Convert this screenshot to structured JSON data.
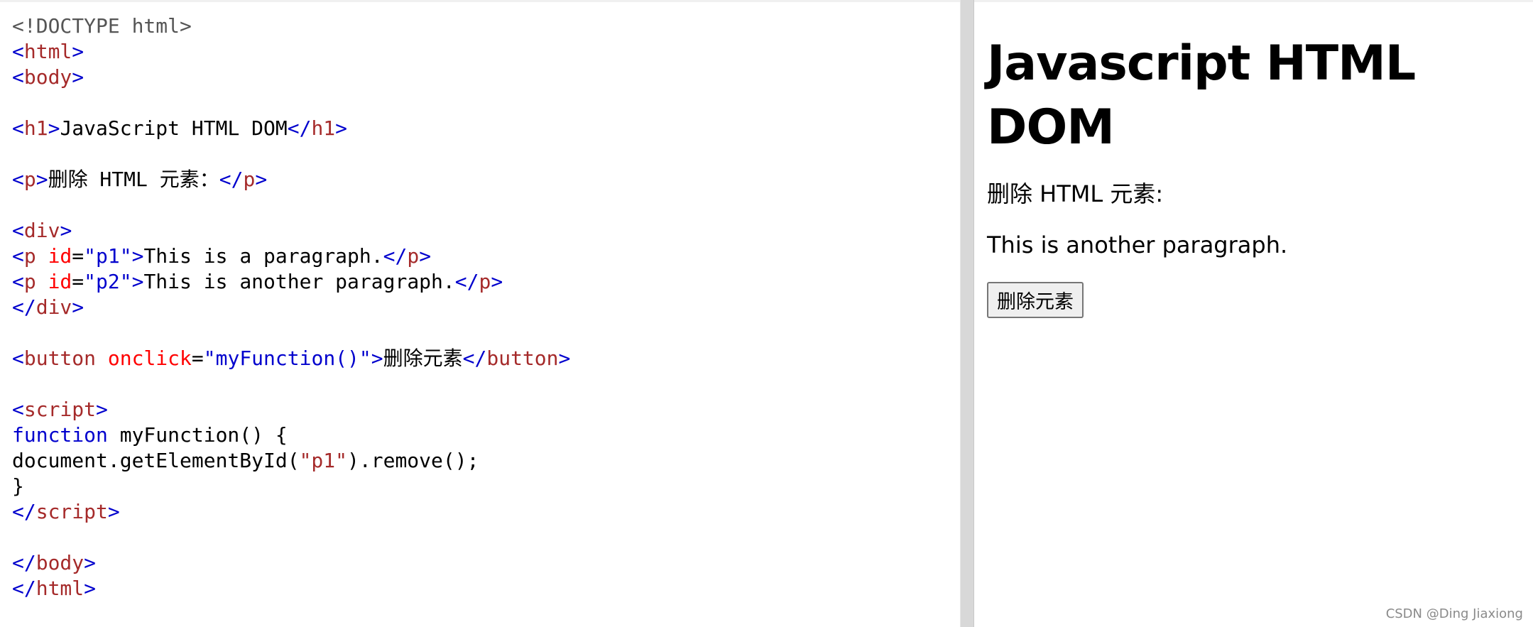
{
  "code_editor": {
    "lines": [
      [
        {
          "c": "t-doc",
          "t": "<!DOCTYPE html>"
        }
      ],
      [
        {
          "c": "t-br",
          "t": "<"
        },
        {
          "c": "t-tag",
          "t": "html"
        },
        {
          "c": "t-br",
          "t": ">"
        }
      ],
      [
        {
          "c": "t-br",
          "t": "<"
        },
        {
          "c": "t-tag",
          "t": "body"
        },
        {
          "c": "t-br",
          "t": ">"
        }
      ],
      [],
      [
        {
          "c": "t-br",
          "t": "<"
        },
        {
          "c": "t-tag",
          "t": "h1"
        },
        {
          "c": "t-br",
          "t": ">"
        },
        {
          "c": "t-txt",
          "t": "JavaScript HTML DOM"
        },
        {
          "c": "t-br",
          "t": "</"
        },
        {
          "c": "t-tag",
          "t": "h1"
        },
        {
          "c": "t-br",
          "t": ">"
        }
      ],
      [],
      [
        {
          "c": "t-br",
          "t": "<"
        },
        {
          "c": "t-tag",
          "t": "p"
        },
        {
          "c": "t-br",
          "t": ">"
        },
        {
          "c": "t-txt",
          "t": "删除 HTML 元素："
        },
        {
          "c": "t-br",
          "t": "</"
        },
        {
          "c": "t-tag",
          "t": "p"
        },
        {
          "c": "t-br",
          "t": ">"
        }
      ],
      [],
      [
        {
          "c": "t-br",
          "t": "<"
        },
        {
          "c": "t-tag",
          "t": "div"
        },
        {
          "c": "t-br",
          "t": ">"
        }
      ],
      [
        {
          "c": "t-br",
          "t": "<"
        },
        {
          "c": "t-tag",
          "t": "p"
        },
        {
          "c": "t-txt",
          "t": " "
        },
        {
          "c": "t-attr",
          "t": "id"
        },
        {
          "c": "t-txt",
          "t": "="
        },
        {
          "c": "t-val",
          "t": "\"p1\""
        },
        {
          "c": "t-br",
          "t": ">"
        },
        {
          "c": "t-txt",
          "t": "This is a paragraph."
        },
        {
          "c": "t-br",
          "t": "</"
        },
        {
          "c": "t-tag",
          "t": "p"
        },
        {
          "c": "t-br",
          "t": ">"
        }
      ],
      [
        {
          "c": "t-br",
          "t": "<"
        },
        {
          "c": "t-tag",
          "t": "p"
        },
        {
          "c": "t-txt",
          "t": " "
        },
        {
          "c": "t-attr",
          "t": "id"
        },
        {
          "c": "t-txt",
          "t": "="
        },
        {
          "c": "t-val",
          "t": "\"p2\""
        },
        {
          "c": "t-br",
          "t": ">"
        },
        {
          "c": "t-txt",
          "t": "This is another paragraph."
        },
        {
          "c": "t-br",
          "t": "</"
        },
        {
          "c": "t-tag",
          "t": "p"
        },
        {
          "c": "t-br",
          "t": ">"
        }
      ],
      [
        {
          "c": "t-br",
          "t": "</"
        },
        {
          "c": "t-tag",
          "t": "div"
        },
        {
          "c": "t-br",
          "t": ">"
        }
      ],
      [],
      [
        {
          "c": "t-br",
          "t": "<"
        },
        {
          "c": "t-tag",
          "t": "button"
        },
        {
          "c": "t-txt",
          "t": " "
        },
        {
          "c": "t-attr",
          "t": "onclick"
        },
        {
          "c": "t-txt",
          "t": "="
        },
        {
          "c": "t-val",
          "t": "\"myFunction()\""
        },
        {
          "c": "t-br",
          "t": ">"
        },
        {
          "c": "t-txt",
          "t": "删除元素"
        },
        {
          "c": "t-br",
          "t": "</"
        },
        {
          "c": "t-tag",
          "t": "button"
        },
        {
          "c": "t-br",
          "t": ">"
        }
      ],
      [],
      [
        {
          "c": "t-br",
          "t": "<"
        },
        {
          "c": "t-tag",
          "t": "script"
        },
        {
          "c": "t-br",
          "t": ">"
        }
      ],
      [
        {
          "c": "t-kw",
          "t": "function"
        },
        {
          "c": "t-txt",
          "t": " myFunction() {"
        }
      ],
      [
        {
          "c": "t-txt",
          "t": "document.getElementById("
        },
        {
          "c": "t-str",
          "t": "\"p1\""
        },
        {
          "c": "t-txt",
          "t": ").remove();"
        }
      ],
      [
        {
          "c": "t-txt",
          "t": "}"
        }
      ],
      [
        {
          "c": "t-br",
          "t": "</"
        },
        {
          "c": "t-tag",
          "t": "script"
        },
        {
          "c": "t-br",
          "t": ">"
        }
      ],
      [],
      [
        {
          "c": "t-br",
          "t": "</"
        },
        {
          "c": "t-tag",
          "t": "body"
        },
        {
          "c": "t-br",
          "t": ">"
        }
      ],
      [
        {
          "c": "t-br",
          "t": "</"
        },
        {
          "c": "t-tag",
          "t": "html"
        },
        {
          "c": "t-br",
          "t": ">"
        }
      ]
    ]
  },
  "result": {
    "heading": "Javascript HTML DOM",
    "label": "删除 HTML 元素:",
    "paragraph": "This is another paragraph.",
    "button_label": "删除元素"
  },
  "watermark": "CSDN @Ding Jiaxiong",
  "colors": {
    "tag": "#a52a2a",
    "bracket": "#0000cd",
    "attribute": "#ff0000",
    "value": "#0000cd",
    "keyword": "#0000cd",
    "doctype": "#555555",
    "divider": "#d8d8d8"
  }
}
